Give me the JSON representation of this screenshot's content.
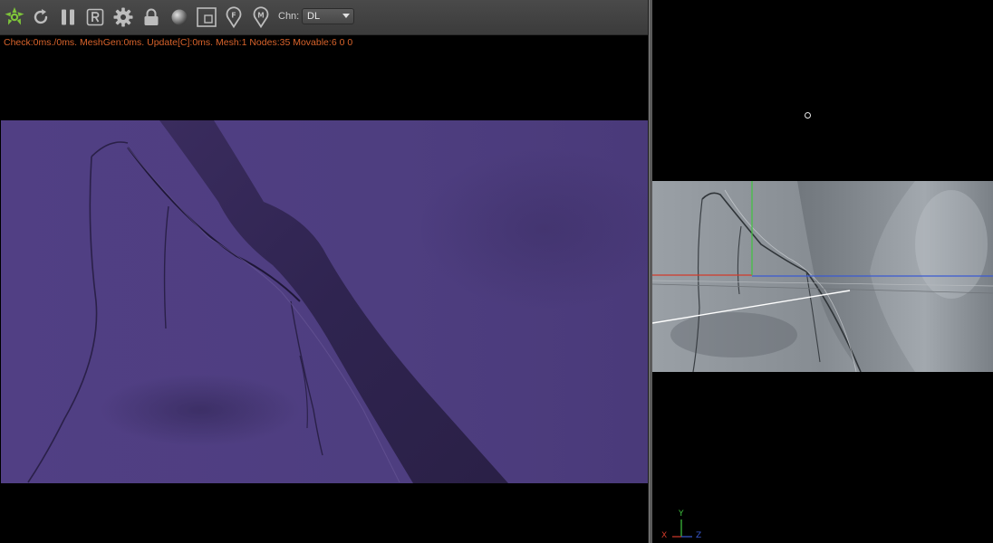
{
  "toolbar": {
    "buttons": [
      {
        "name": "render-logo-button",
        "icon": "octane-logo-icon"
      },
      {
        "name": "restart-render-button",
        "icon": "refresh-icon"
      },
      {
        "name": "pause-render-button",
        "icon": "pause-icon"
      },
      {
        "name": "region-render-button",
        "icon": "r-box-icon"
      },
      {
        "name": "settings-button",
        "icon": "gear-icon"
      },
      {
        "name": "lock-button",
        "icon": "lock-icon"
      },
      {
        "name": "material-preview-button",
        "icon": "sphere-icon"
      },
      {
        "name": "region-select-button",
        "icon": "region-box-icon"
      },
      {
        "name": "focus-picker-button",
        "icon": "pin-f-icon",
        "letter": "F"
      },
      {
        "name": "material-picker-button",
        "icon": "pin-m-icon",
        "letter": "M"
      }
    ],
    "channel_label": "Chn:",
    "channel_value": "DL"
  },
  "status": {
    "text": "Check:0ms./0ms. MeshGen:0ms. Update[C]:0ms. Mesh:1 Nodes:35 Movable:6  0 0"
  },
  "colors": {
    "status_text": "#d8632b",
    "logo_green": "#7ec43a",
    "render_purple": "#4e3d80",
    "viewport_gray": "#8a9096",
    "axis_x": "#d23a2a",
    "axis_y": "#3fc43f",
    "axis_z": "#3a5ad2"
  },
  "axis_gizmo": {
    "x_label": "X",
    "y_label": "Y",
    "z_label": "Z"
  }
}
